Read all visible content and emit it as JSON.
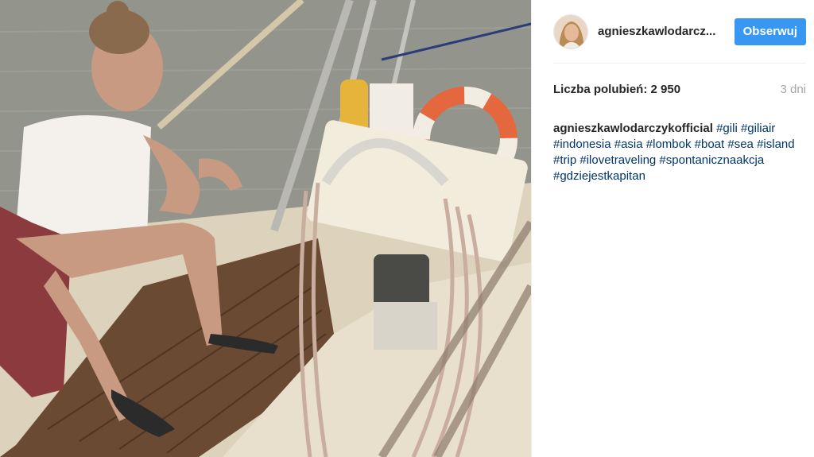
{
  "photo": {
    "description_icon": "photo-image"
  },
  "header": {
    "username": "agnieszkawlodarcz...",
    "follow_label": "Obserwuj"
  },
  "meta": {
    "likes_text": "Liczba polubień: 2 950",
    "age_text": "3 dni"
  },
  "caption": {
    "author": "agnieszkawlodarczykofficial",
    "hashtags": [
      "#gili",
      "#giliair",
      "#indonesia",
      "#asia",
      "#lombok",
      "#boat",
      "#sea",
      "#island",
      "#trip",
      "#ilovetraveling",
      "#spontanicznaakcja",
      "#gdziejestkapitan"
    ]
  },
  "colors": {
    "follow_button": "#3897f0",
    "hashtag": "#003569",
    "muted": "#a5a7aa"
  }
}
